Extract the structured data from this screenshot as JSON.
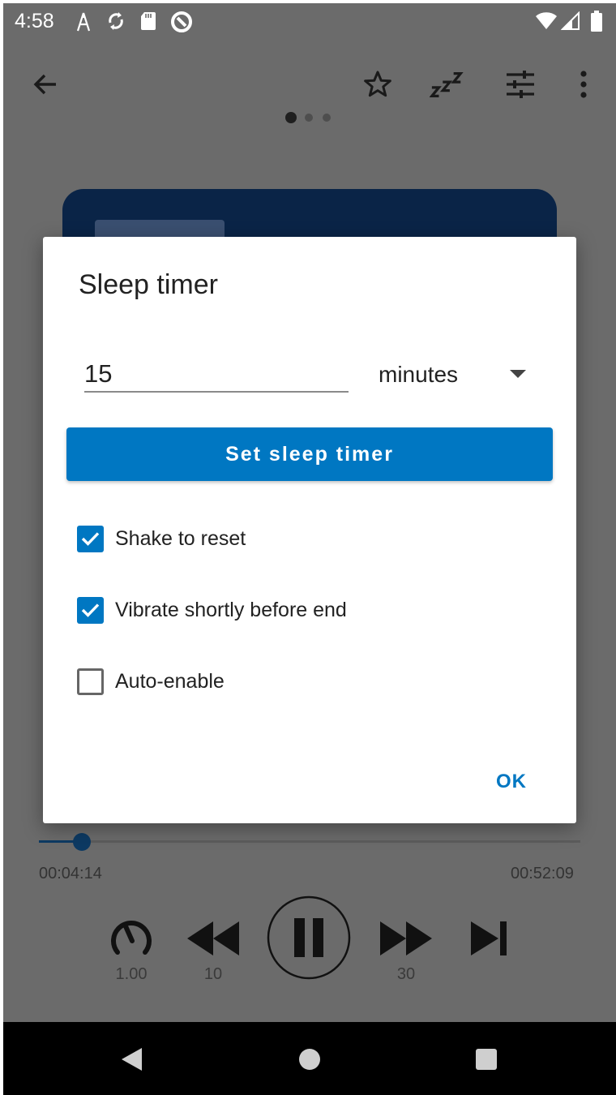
{
  "status_bar": {
    "time": "4:58"
  },
  "toolbar": {
    "icons": [
      "back-arrow-icon",
      "star-icon",
      "sleep-zzz-icon",
      "tune-sliders-icon",
      "more-vert-icon"
    ],
    "page_indicator_count": 3,
    "active_page": 0
  },
  "player": {
    "position": "00:04:14",
    "duration": "00:52:09",
    "progress": 0.081,
    "speed_label": "1.00",
    "rewind_label": "10",
    "forward_label": "30"
  },
  "dialog": {
    "title": "Sleep timer",
    "time_value": "15",
    "unit": "minutes",
    "set_button": "Set sleep timer",
    "options": [
      {
        "label": "Shake to reset",
        "checked": true
      },
      {
        "label": "Vibrate shortly before end",
        "checked": true
      },
      {
        "label": "Auto-enable",
        "checked": false
      }
    ],
    "ok_button": "OK"
  },
  "colors": {
    "accent": "#0077c2",
    "scrim": "#6b6b6b",
    "cover": "#0a2447"
  }
}
